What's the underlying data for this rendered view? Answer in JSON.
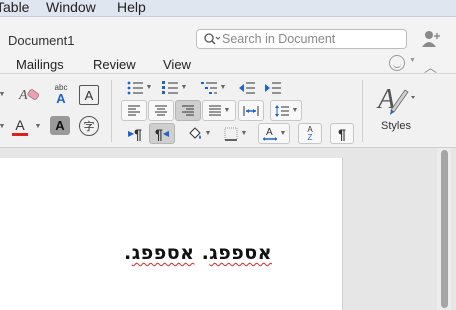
{
  "menubar": {
    "items": [
      "Table",
      "Window",
      "Help"
    ]
  },
  "window": {
    "title": "Document1"
  },
  "search": {
    "placeholder": "Search in Document"
  },
  "tabs": [
    "Mailings",
    "Review",
    "View"
  ],
  "ribbon": {
    "clear_icon_label": "A",
    "spell_label_top": "abc",
    "spell_label_bottom": "A",
    "boxed_a_label": "A",
    "font_color_label": "A",
    "highlight_a_label": "A",
    "enclose_label": "字",
    "sort_label_top": "A",
    "sort_label_bottom": "Z",
    "pilcrow_label": "¶",
    "ltr_label": "¶",
    "rtl_label": "¶",
    "styles_label": "Styles",
    "accent_red": "#e02020"
  },
  "document": {
    "words": [
      "אספפג",
      "אספפג"
    ],
    "separator": ". ",
    "end": "."
  }
}
